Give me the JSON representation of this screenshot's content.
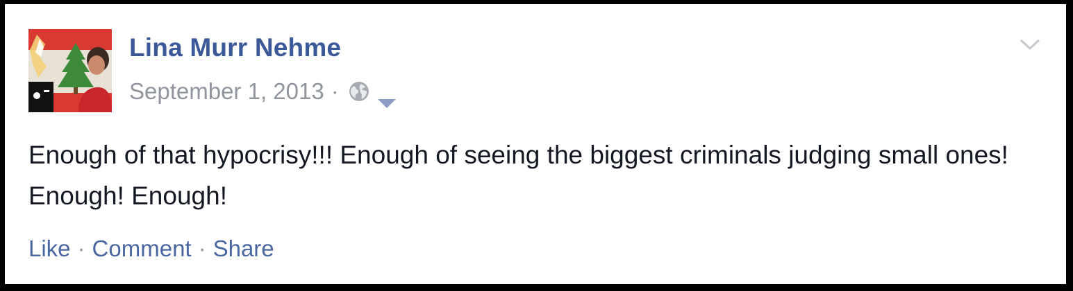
{
  "post": {
    "author": "Lina Murr Nehme",
    "timestamp": "September 1, 2013",
    "separator": "·",
    "audience_icon": "globe-icon",
    "audience_menu_icon": "caret-down-icon",
    "menu_icon": "chevron-down-icon",
    "body": "Enough of that hypocrisy!!! Enough of seeing the biggest criminals judging small ones! Enough! Enough!",
    "actions": {
      "like": "Like",
      "comment": "Comment",
      "share": "Share",
      "separator": "·"
    }
  },
  "colors": {
    "author_link": "#3b5998",
    "action_link": "#4b67a1",
    "meta_text": "#90949c",
    "body_text": "#141823"
  }
}
